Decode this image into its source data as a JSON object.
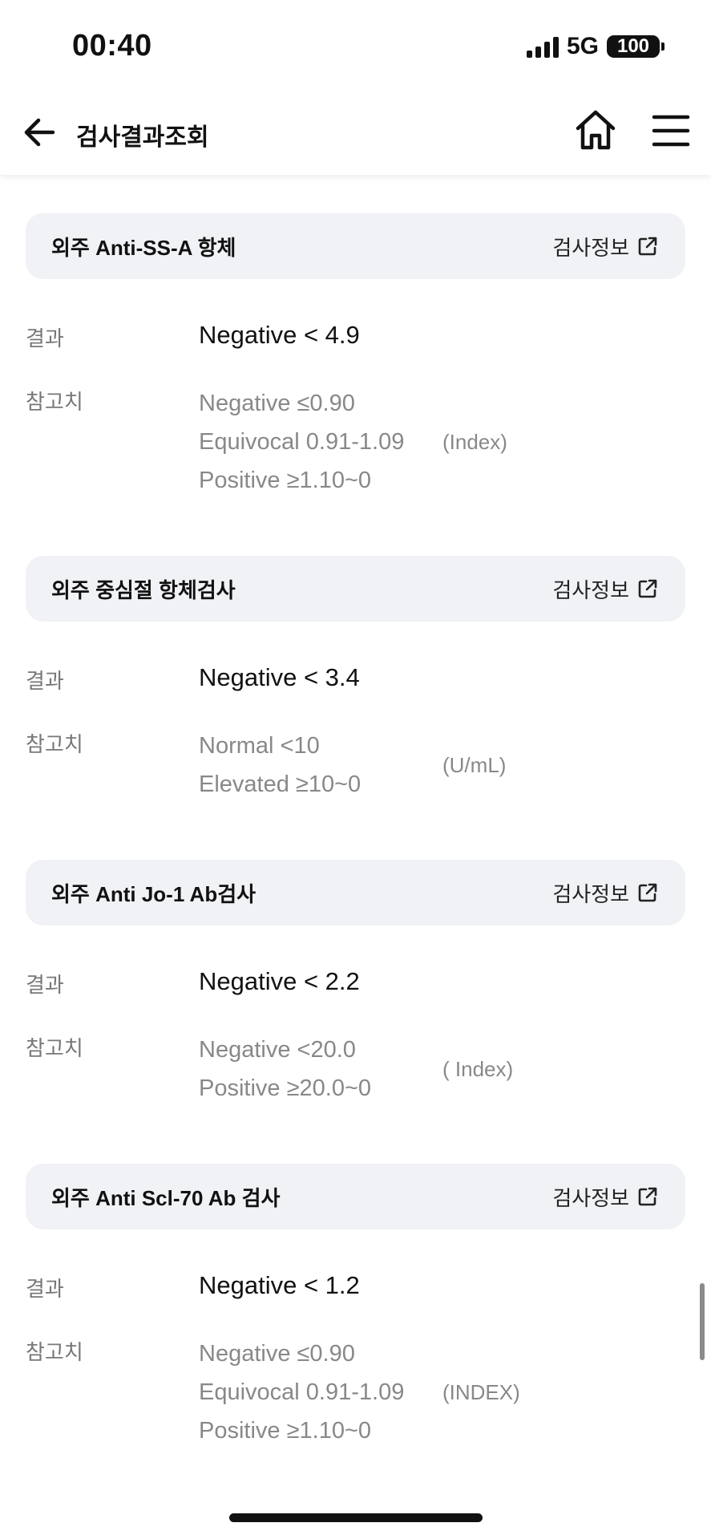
{
  "status_bar": {
    "time": "00:40",
    "network": "5G",
    "battery": "100"
  },
  "header": {
    "title": "검사결과조회"
  },
  "labels": {
    "result": "결과",
    "reference": "참고치",
    "info_link": "검사정보"
  },
  "tests": [
    {
      "name": "외주 Anti-SS-A 항체",
      "result": "Negative < 4.9",
      "reference": [
        "Negative ≤0.90",
        "Equivocal 0.91-1.09",
        "Positive ≥1.10~0"
      ],
      "unit": "(Index)"
    },
    {
      "name": "외주 중심절 항체검사",
      "result": "Negative < 3.4",
      "reference": [
        "Normal <10",
        "Elevated ≥10~0"
      ],
      "unit": "(U/mL)"
    },
    {
      "name": "외주 Anti Jo-1 Ab검사",
      "result": "Negative < 2.2",
      "reference": [
        "Negative <20.0",
        "Positive ≥20.0~0"
      ],
      "unit": "( Index)"
    },
    {
      "name": "외주 Anti Scl-70 Ab 검사",
      "result": "Negative < 1.2",
      "reference": [
        "Negative ≤0.90",
        "Equivocal 0.91-1.09",
        "Positive ≥1.10~0"
      ],
      "unit": "(INDEX)"
    }
  ]
}
